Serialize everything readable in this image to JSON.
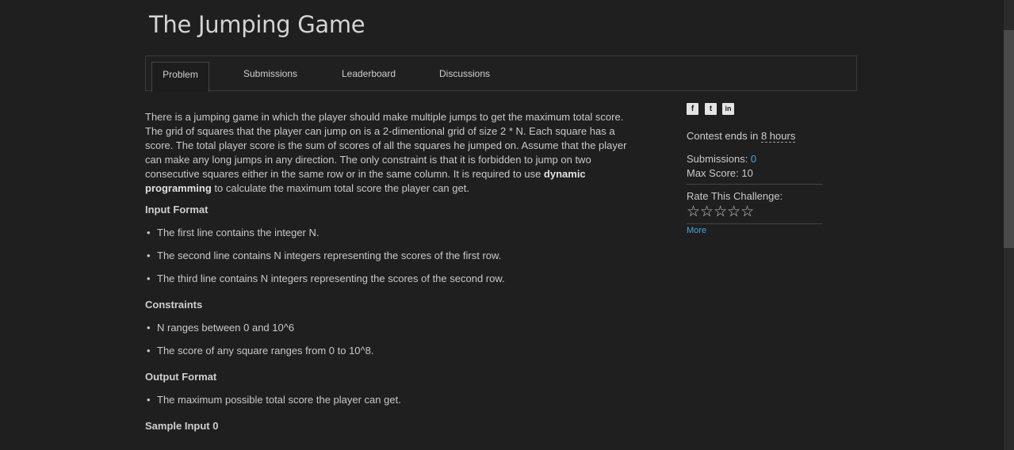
{
  "page": {
    "title": "The Jumping Game"
  },
  "tabs": [
    {
      "label": "Problem",
      "active": true
    },
    {
      "label": "Submissions",
      "active": false
    },
    {
      "label": "Leaderboard",
      "active": false
    },
    {
      "label": "Discussions",
      "active": false
    }
  ],
  "problem": {
    "intro_1": "There is a jumping game in which the player should make multiple jumps to get the maximum total score. The grid of squares that the player can jump on is a 2-dimentional grid of size 2 * N. Each square has a score. The total player score is the sum of scores of all the squares he jumped on. Assume that the player can make any long jumps in any direction. The only constraint is that it is forbidden to jump on two consecutive squares either in the same row or in the same column. It is required to use ",
    "intro_bold": "dynamic programming",
    "intro_2": " to calculate the maximum total score the player can get.",
    "input_format_heading": "Input Format",
    "input_format": [
      "The first line contains the integer N.",
      "The second line contains N integers representing the scores of the first row.",
      "The third line contains N integers representing the scores of the second row."
    ],
    "constraints_heading": "Constraints",
    "constraints": [
      "N ranges between 0 and 10^6",
      "The score of any square ranges from 0 to 10^8."
    ],
    "output_format_heading": "Output Format",
    "output_format": [
      "The maximum possible total score the player can get."
    ],
    "sample_input_heading": "Sample Input 0"
  },
  "sidebar": {
    "social": [
      {
        "icon": "facebook-icon",
        "glyph": "f"
      },
      {
        "icon": "twitter-icon",
        "glyph": "t"
      },
      {
        "icon": "linkedin-icon",
        "glyph": "in"
      }
    ],
    "contest_prefix": "Contest ends in ",
    "contest_hours": "8 hours",
    "submissions_label": "Submissions: ",
    "submissions_value": "0",
    "max_score_label": "Max Score: ",
    "max_score_value": "10",
    "rate_label": "Rate This Challenge:",
    "stars": "☆☆☆☆☆",
    "rating_stars_filled": 0,
    "more_label": "More"
  },
  "colors": {
    "background": "#1f1f1f",
    "accent": "#4aa3df",
    "text": "#c9c9c9"
  }
}
